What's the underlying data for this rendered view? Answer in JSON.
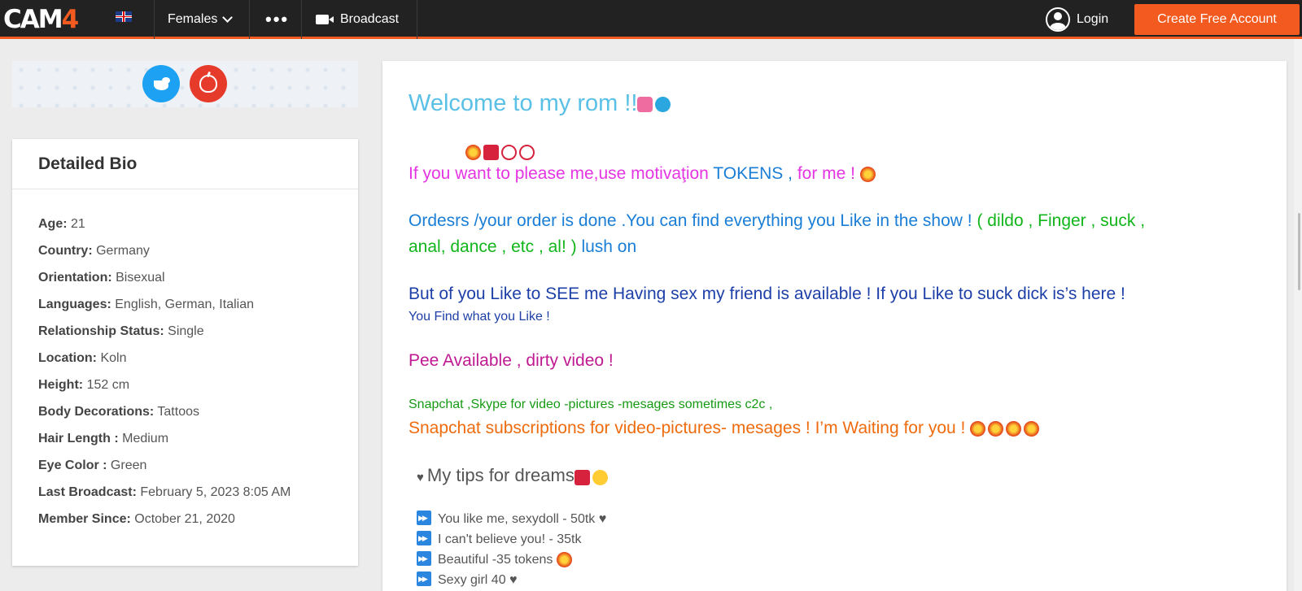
{
  "header": {
    "logo_text_cam": "CAM",
    "logo_text_four": "4",
    "nav_females": "Females",
    "nav_more": "•••",
    "nav_broadcast": "Broadcast",
    "login": "Login",
    "cta": "Create Free Account",
    "accent_color": "#f25a1f"
  },
  "bio": {
    "title": "Detailed Bio",
    "rows": [
      {
        "label": "Age:",
        "value": "21"
      },
      {
        "label": "Country:",
        "value": "Germany"
      },
      {
        "label": "Orientation:",
        "value": "Bisexual"
      },
      {
        "label": "Languages:",
        "value": "English, German, Italian"
      },
      {
        "label": "Relationship Status:",
        "value": "Single"
      },
      {
        "label": "Location:",
        "value": "Koln"
      },
      {
        "label": "Height:",
        "value": "152 cm"
      },
      {
        "label": "Body Decorations:",
        "value": "Tattoos"
      },
      {
        "label": "Hair Length :",
        "value": "Medium"
      },
      {
        "label": "Eye Color :",
        "value": "Green"
      },
      {
        "label": "Last Broadcast:",
        "value": "February 5, 2023 8:05 AM"
      },
      {
        "label": "Member Since:",
        "value": "October 21, 2020"
      }
    ]
  },
  "about": {
    "welcome": "Welcome to my rom !!",
    "line1_a": "If you want to please me,use motivaţion ",
    "line1_b": "TOKENS , ",
    "line1_c": "for me ! ",
    "line2_a": "  Ordesrs /your order is done .You can find everything you Like in the show !   ",
    "line2_b": "( dildo , Finger , suck ,",
    "line3_a": "anal, dance , etc , al! )   ",
    "line3_b": "lush on",
    "line4": "But of you Like to SEE me Having sex my friend is available ! If you Like to suck dick is’s here !",
    "line5": "You Find what you Like !",
    "line6": "Pee Available , dirty video !",
    "line7": "Snapchat ,Skype for video -pictures -mesages sometimes c2c ,",
    "line8": "Snapchat subscriptions for video-pictures- mesages ! I’m Waiting for you !  ",
    "tips_heart": "♥",
    "tips_title": "My tips for dreams",
    "tips": [
      "You like me, sexydoll - 50tk ♥",
      "I can't believe you!  - 35tk",
      "Beautiful -35 tokens ",
      "Sexy girl 40 ♥"
    ]
  }
}
